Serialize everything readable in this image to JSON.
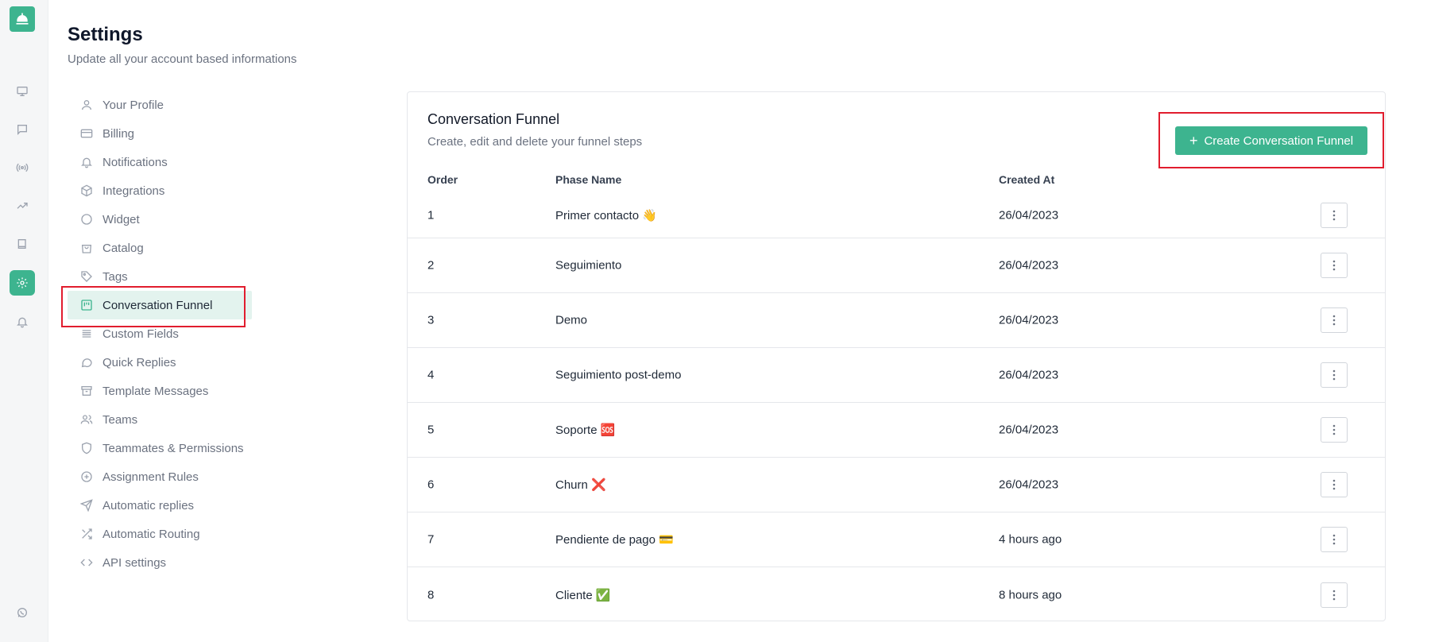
{
  "header": {
    "title": "Settings",
    "subtitle": "Update all your account based informations"
  },
  "rail": {
    "items": [
      {
        "icon": "bell-concierge-logo"
      },
      {
        "icon": "monitor-icon"
      },
      {
        "icon": "chat-bubble-icon"
      },
      {
        "icon": "broadcast-icon"
      },
      {
        "icon": "trending-up-icon"
      },
      {
        "icon": "book-icon"
      },
      {
        "icon": "gear-icon",
        "active": true
      },
      {
        "icon": "bell-icon"
      },
      {
        "icon": "whatsapp-icon"
      }
    ],
    "accent": "#3db48f"
  },
  "nav": {
    "items": [
      {
        "label": "Your Profile",
        "icon": "user-icon"
      },
      {
        "label": "Billing",
        "icon": "credit-card-icon"
      },
      {
        "label": "Notifications",
        "icon": "bell-icon"
      },
      {
        "label": "Integrations",
        "icon": "cube-icon"
      },
      {
        "label": "Widget",
        "icon": "circle-icon"
      },
      {
        "label": "Catalog",
        "icon": "shopping-bag-icon"
      },
      {
        "label": "Tags",
        "icon": "tag-icon"
      },
      {
        "label": "Conversation Funnel",
        "icon": "kanban-icon",
        "active": true
      },
      {
        "label": "Custom Fields",
        "icon": "list-icon"
      },
      {
        "label": "Quick Replies",
        "icon": "message-circle-icon"
      },
      {
        "label": "Template Messages",
        "icon": "archive-icon"
      },
      {
        "label": "Teams",
        "icon": "users-icon"
      },
      {
        "label": "Teammates & Permissions",
        "icon": "shield-icon"
      },
      {
        "label": "Assignment Rules",
        "icon": "plus-circle-icon"
      },
      {
        "label": "Automatic replies",
        "icon": "send-icon"
      },
      {
        "label": "Automatic Routing",
        "icon": "shuffle-icon"
      },
      {
        "label": "API settings",
        "icon": "code-icon"
      }
    ]
  },
  "funnel": {
    "title": "Conversation Funnel",
    "subtitle": "Create, edit and delete your funnel steps",
    "create_button": "Create Conversation Funnel",
    "columns": {
      "order": "Order",
      "name": "Phase Name",
      "created": "Created At"
    },
    "rows": [
      {
        "order": "1",
        "name": "Primer contacto 👋",
        "created": "26/04/2023"
      },
      {
        "order": "2",
        "name": "Seguimiento",
        "created": "26/04/2023"
      },
      {
        "order": "3",
        "name": "Demo",
        "created": "26/04/2023"
      },
      {
        "order": "4",
        "name": "Seguimiento post-demo",
        "created": "26/04/2023"
      },
      {
        "order": "5",
        "name": "Soporte 🆘",
        "created": "26/04/2023"
      },
      {
        "order": "6",
        "name": "Churn ❌",
        "created": "26/04/2023"
      },
      {
        "order": "7",
        "name": "Pendiente de pago 💳",
        "created": "4 hours ago"
      },
      {
        "order": "8",
        "name": "Cliente ✅",
        "created": "8 hours ago"
      }
    ]
  }
}
